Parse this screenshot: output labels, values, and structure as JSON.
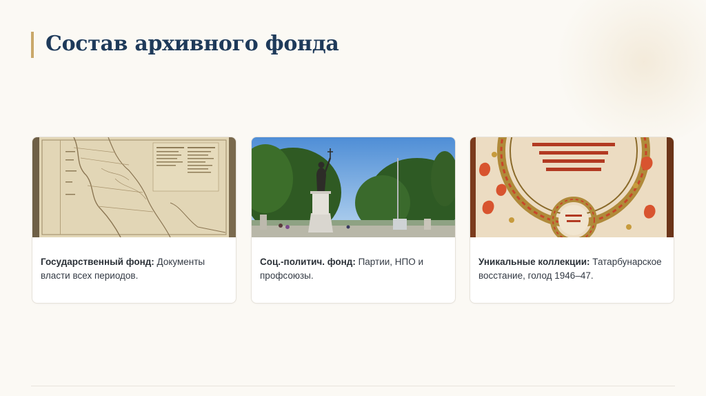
{
  "slide": {
    "title": "Состав архивного фонда"
  },
  "cards": [
    {
      "image_subject": "historical-map",
      "bold": "Государственный фонд:",
      "text": " Документы власти всех периодов."
    },
    {
      "image_subject": "monument-statue-in-park",
      "bold": "Соц.-политич. фонд:",
      "text": " Партии, НПО и профсоюзы."
    },
    {
      "image_subject": "illuminated-manuscript",
      "bold": "Уникальные коллекции:",
      "text": " Татарбунарское восстание, голод 1946–47."
    }
  ],
  "colors": {
    "background": "#fbf9f4",
    "title": "#1e3a5a",
    "accent_bar": "#c9a86a",
    "card_border": "#e6e2da"
  }
}
